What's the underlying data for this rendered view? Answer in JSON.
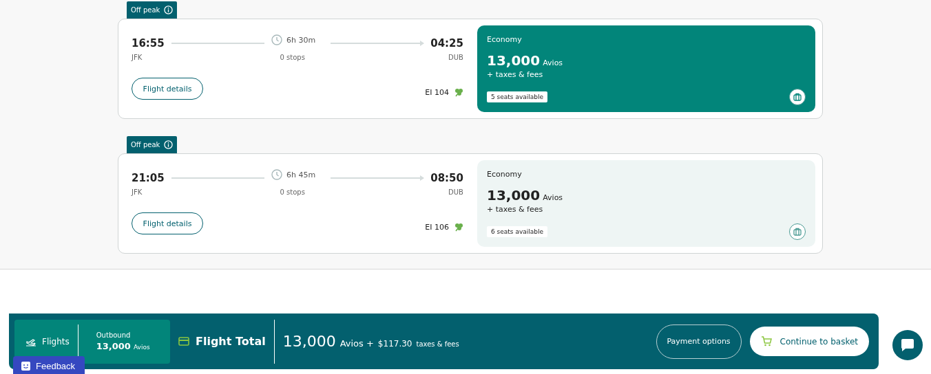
{
  "flights": [
    {
      "tag": "Off peak",
      "depart_time": "16:55",
      "depart_airport": "JFK",
      "duration": "6h 30m",
      "stops": "0 stops",
      "arrive_time": "04:25",
      "arrive_airport": "DUB",
      "details_button": "Flight details",
      "flight_number": "EI 104",
      "fare": {
        "cabin": "Economy",
        "avios": "13,000",
        "avios_unit": "Avios",
        "taxes": "+ taxes & fees",
        "seats": "5 seats available",
        "selected": true
      }
    },
    {
      "tag": "Off peak",
      "depart_time": "21:05",
      "depart_airport": "JFK",
      "duration": "6h 45m",
      "stops": "0 stops",
      "arrive_time": "08:50",
      "arrive_airport": "DUB",
      "details_button": "Flight details",
      "flight_number": "EI 106",
      "fare": {
        "cabin": "Economy",
        "avios": "13,000",
        "avios_unit": "Avios",
        "taxes": "+ taxes & fees",
        "seats": "6 seats available",
        "selected": false
      }
    }
  ],
  "summary": {
    "flights_label": "Flights",
    "outbound_label": "Outbound",
    "outbound_avios": "13,000",
    "outbound_unit": "Avios",
    "total_label": "Flight Total",
    "total_avios": "13,000",
    "total_avios_unit": "Avios +",
    "total_cash": "$117.30",
    "total_cash_note": "taxes & fees",
    "payment_button": "Payment options",
    "continue_button": "Continue to basket"
  },
  "feedback": "Feedback"
}
